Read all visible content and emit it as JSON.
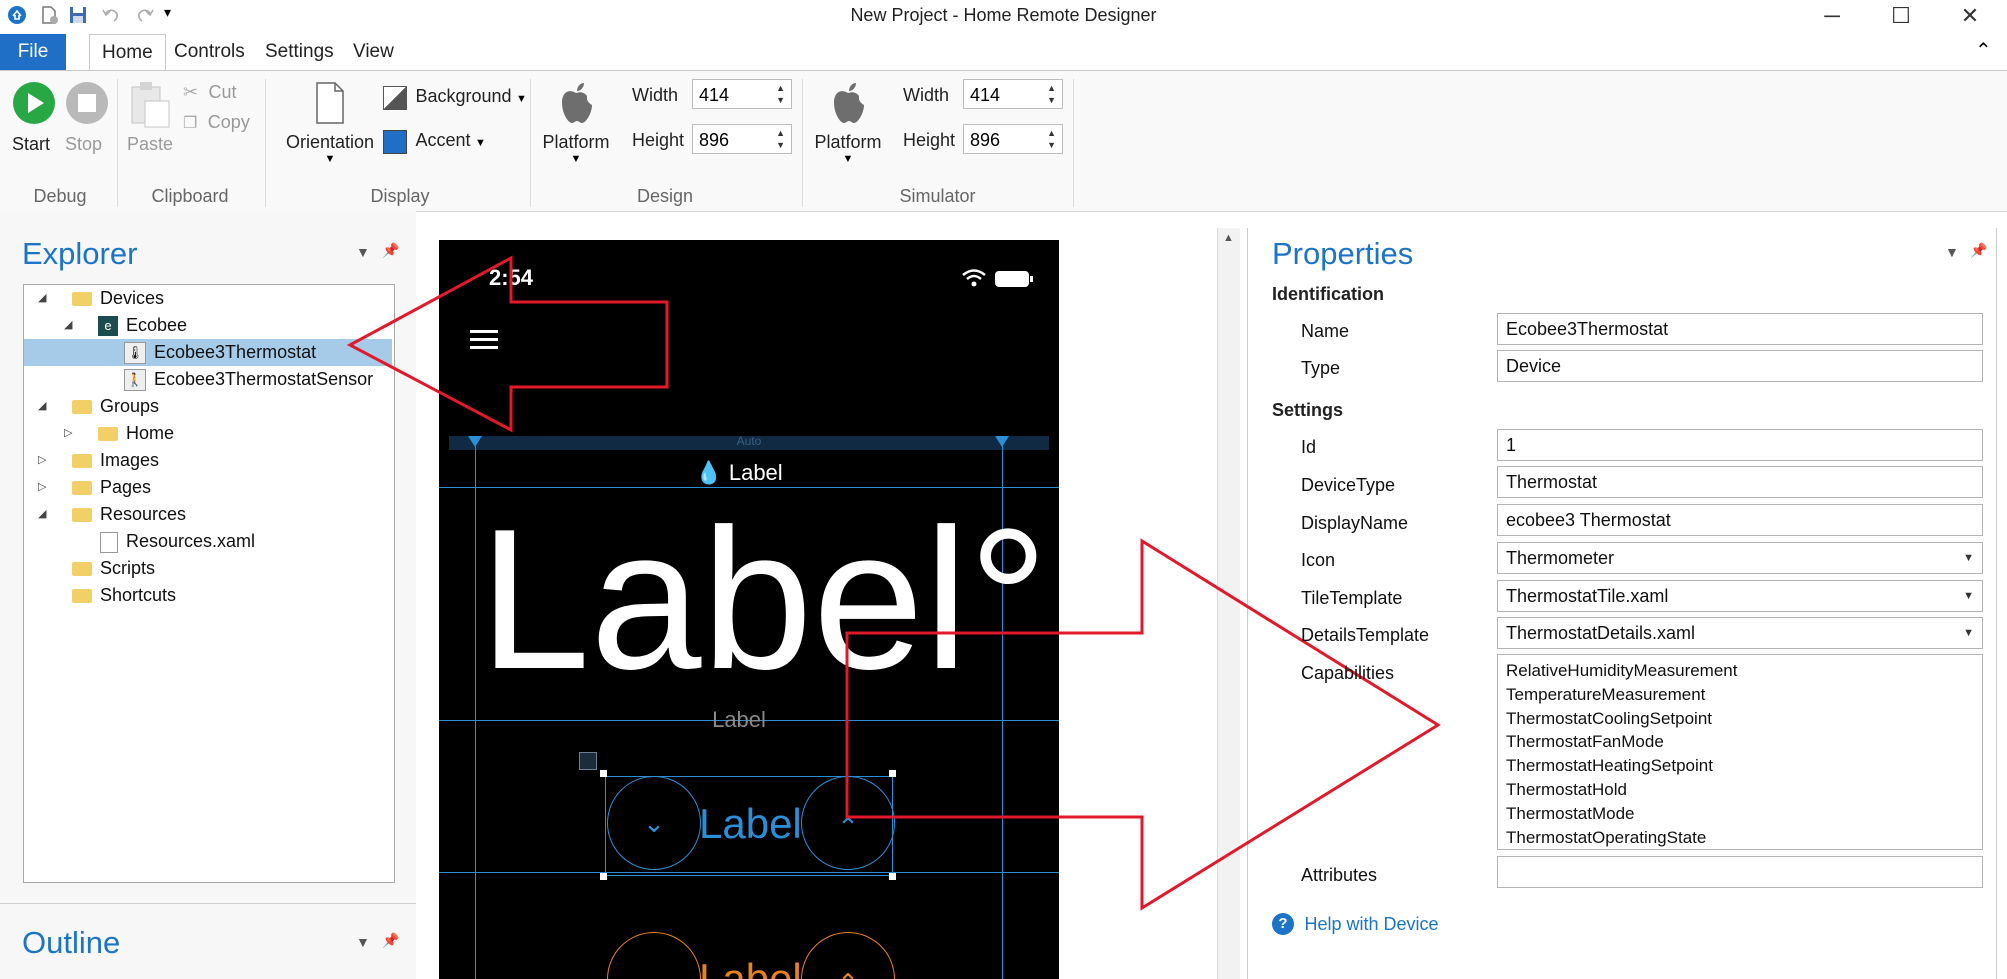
{
  "window": {
    "title": "New Project - Home Remote Designer",
    "minimize": "─",
    "maximize": "☐",
    "close": "✕"
  },
  "tabs": [
    "File",
    "Home",
    "Controls",
    "Settings",
    "View"
  ],
  "ribbon": {
    "debug": {
      "start": "Start",
      "stop": "Stop",
      "group": "Debug"
    },
    "clipboard": {
      "paste": "Paste",
      "cut": "Cut",
      "copy": "Copy",
      "group": "Clipboard"
    },
    "display": {
      "orientation": "Orientation",
      "background": "Background",
      "accent": "Accent",
      "group": "Display"
    },
    "design": {
      "platform": "Platform",
      "width_label": "Width",
      "width": "414",
      "height_label": "Height",
      "height": "896",
      "group": "Design"
    },
    "simulator": {
      "platform": "Platform",
      "width_label": "Width",
      "width": "414",
      "height_label": "Height",
      "height": "896",
      "group": "Simulator"
    }
  },
  "explorer": {
    "title": "Explorer",
    "items": [
      "Devices",
      "Ecobee",
      "Ecobee3Thermostat",
      "Ecobee3ThermostatSensor",
      "Groups",
      "Home",
      "Images",
      "Pages",
      "Resources",
      "Resources.xaml",
      "Scripts",
      "Shortcuts"
    ]
  },
  "outline": {
    "title": "Outline"
  },
  "phone": {
    "time": "2:54",
    "auto": "Auto",
    "small_label": "Label",
    "big_label": "Label°",
    "gray_label": "Label",
    "blue_label": "Label",
    "orange_label": "Label"
  },
  "properties": {
    "title": "Properties",
    "identification": "Identification",
    "name_label": "Name",
    "name": "Ecobee3Thermostat",
    "type_label": "Type",
    "type": "Device",
    "settings": "Settings",
    "id_label": "Id",
    "id": "1",
    "devicetype_label": "DeviceType",
    "devicetype": "Thermostat",
    "displayname_label": "DisplayName",
    "displayname": "ecobee3 Thermostat",
    "icon_label": "Icon",
    "icon": "Thermometer",
    "tiletemplate_label": "TileTemplate",
    "tiletemplate": "ThermostatTile.xaml",
    "detailstemplate_label": "DetailsTemplate",
    "detailstemplate": "ThermostatDetails.xaml",
    "capabilities_label": "Capabilities",
    "capabilities": [
      "RelativeHumidityMeasurement",
      "TemperatureMeasurement",
      "ThermostatCoolingSetpoint",
      "ThermostatFanMode",
      "ThermostatHeatingSetpoint",
      "ThermostatHold",
      "ThermostatMode",
      "ThermostatOperatingState"
    ],
    "attributes_label": "Attributes",
    "help": "Help with Device"
  },
  "colors": {
    "accent_blue": "#1b74c8",
    "file_tab": "#1f6fc7",
    "play_green": "#27a845",
    "arrow_red": "#e2192a",
    "design_blue": "#2a8fd6",
    "orange": "#e8821e"
  }
}
